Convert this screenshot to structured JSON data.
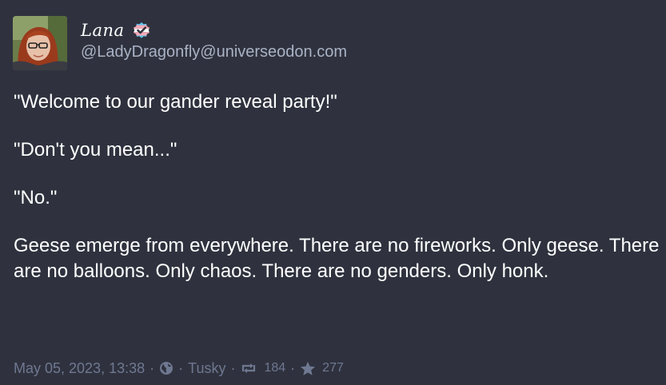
{
  "author": {
    "display_name": "Lana",
    "handle": "@LadyDragonfly@universeodon.com",
    "avatar_icon": "avatar-photo",
    "badge_icon": "trans-flag-verified-icon"
  },
  "post": {
    "paragraphs": [
      "\"Welcome to our gander reveal party!\"",
      "\"Don't you mean...\"",
      "\"No.\"",
      "Geese emerge from everywhere. There are no fireworks. Only geese. There are no balloons. Only chaos. There are no genders. Only honk."
    ]
  },
  "footer": {
    "timestamp": "May 05, 2023, 13:38",
    "visibility_icon": "globe-icon",
    "client": "Tusky",
    "boost_icon": "boost-icon",
    "boosts": "184",
    "favourite_icon": "star-icon",
    "favourites": "277",
    "separator": "·"
  },
  "colors": {
    "background": "#2f323e",
    "text": "#ffffff",
    "handle": "#aab2c5",
    "meta": "#6f7891",
    "badge_blue": "#5bcefa",
    "badge_pink": "#f5a9b8"
  }
}
